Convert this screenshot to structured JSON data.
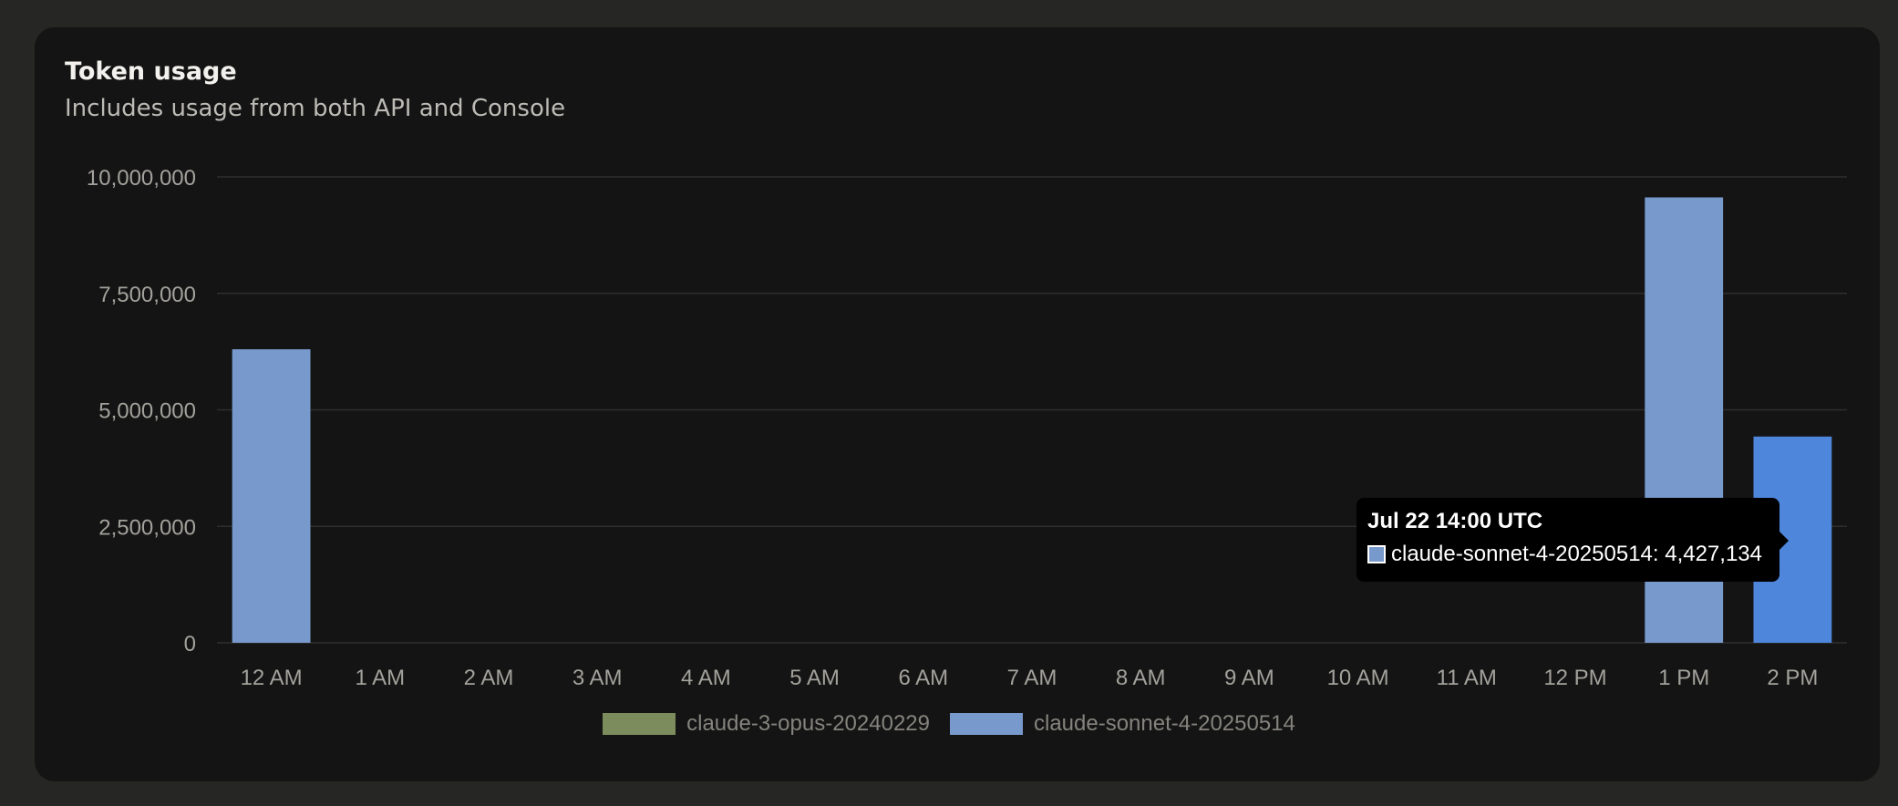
{
  "card": {
    "title": "Token usage",
    "subtitle": "Includes usage from both API and Console"
  },
  "colors": {
    "card_background": "#141414",
    "page_background": "#262624",
    "grid": "#2e2e2e",
    "axis_text": "#a3a19b",
    "series_opus": "#7c8c5c",
    "series_sonnet": "#7799cc",
    "highlight_bar": "#4e86db"
  },
  "chart_data": {
    "type": "bar",
    "title": "Token usage",
    "subtitle": "Includes usage from both API and Console",
    "categories": [
      "12 AM",
      "1 AM",
      "2 AM",
      "3 AM",
      "4 AM",
      "5 AM",
      "6 AM",
      "7 AM",
      "8 AM",
      "9 AM",
      "10 AM",
      "11 AM",
      "12 PM",
      "1 PM",
      "2 PM"
    ],
    "series": [
      {
        "name": "claude-3-opus-20240229",
        "color": "#7c8c5c",
        "values": [
          0,
          0,
          0,
          0,
          0,
          0,
          0,
          0,
          0,
          0,
          0,
          0,
          0,
          0,
          0
        ]
      },
      {
        "name": "claude-sonnet-4-20250514",
        "color": "#7799cc",
        "values": [
          6300000,
          0,
          0,
          0,
          0,
          0,
          0,
          0,
          0,
          0,
          0,
          0,
          0,
          9560000,
          4427134
        ]
      }
    ],
    "ylim": [
      0,
      10000000
    ],
    "yticks": [
      0,
      2500000,
      5000000,
      7500000,
      10000000
    ],
    "ytick_labels": [
      "0",
      "2,500,000",
      "5,000,000",
      "7,500,000",
      "10,000,000"
    ],
    "grid": true,
    "legend_position": "bottom-center",
    "highlighted_index": 14,
    "tooltip": {
      "title": "Jul 22 14:00 UTC",
      "series": "claude-sonnet-4-20250514",
      "value_label": "4,427,134",
      "text": "claude-sonnet-4-20250514: 4,427,134"
    }
  }
}
